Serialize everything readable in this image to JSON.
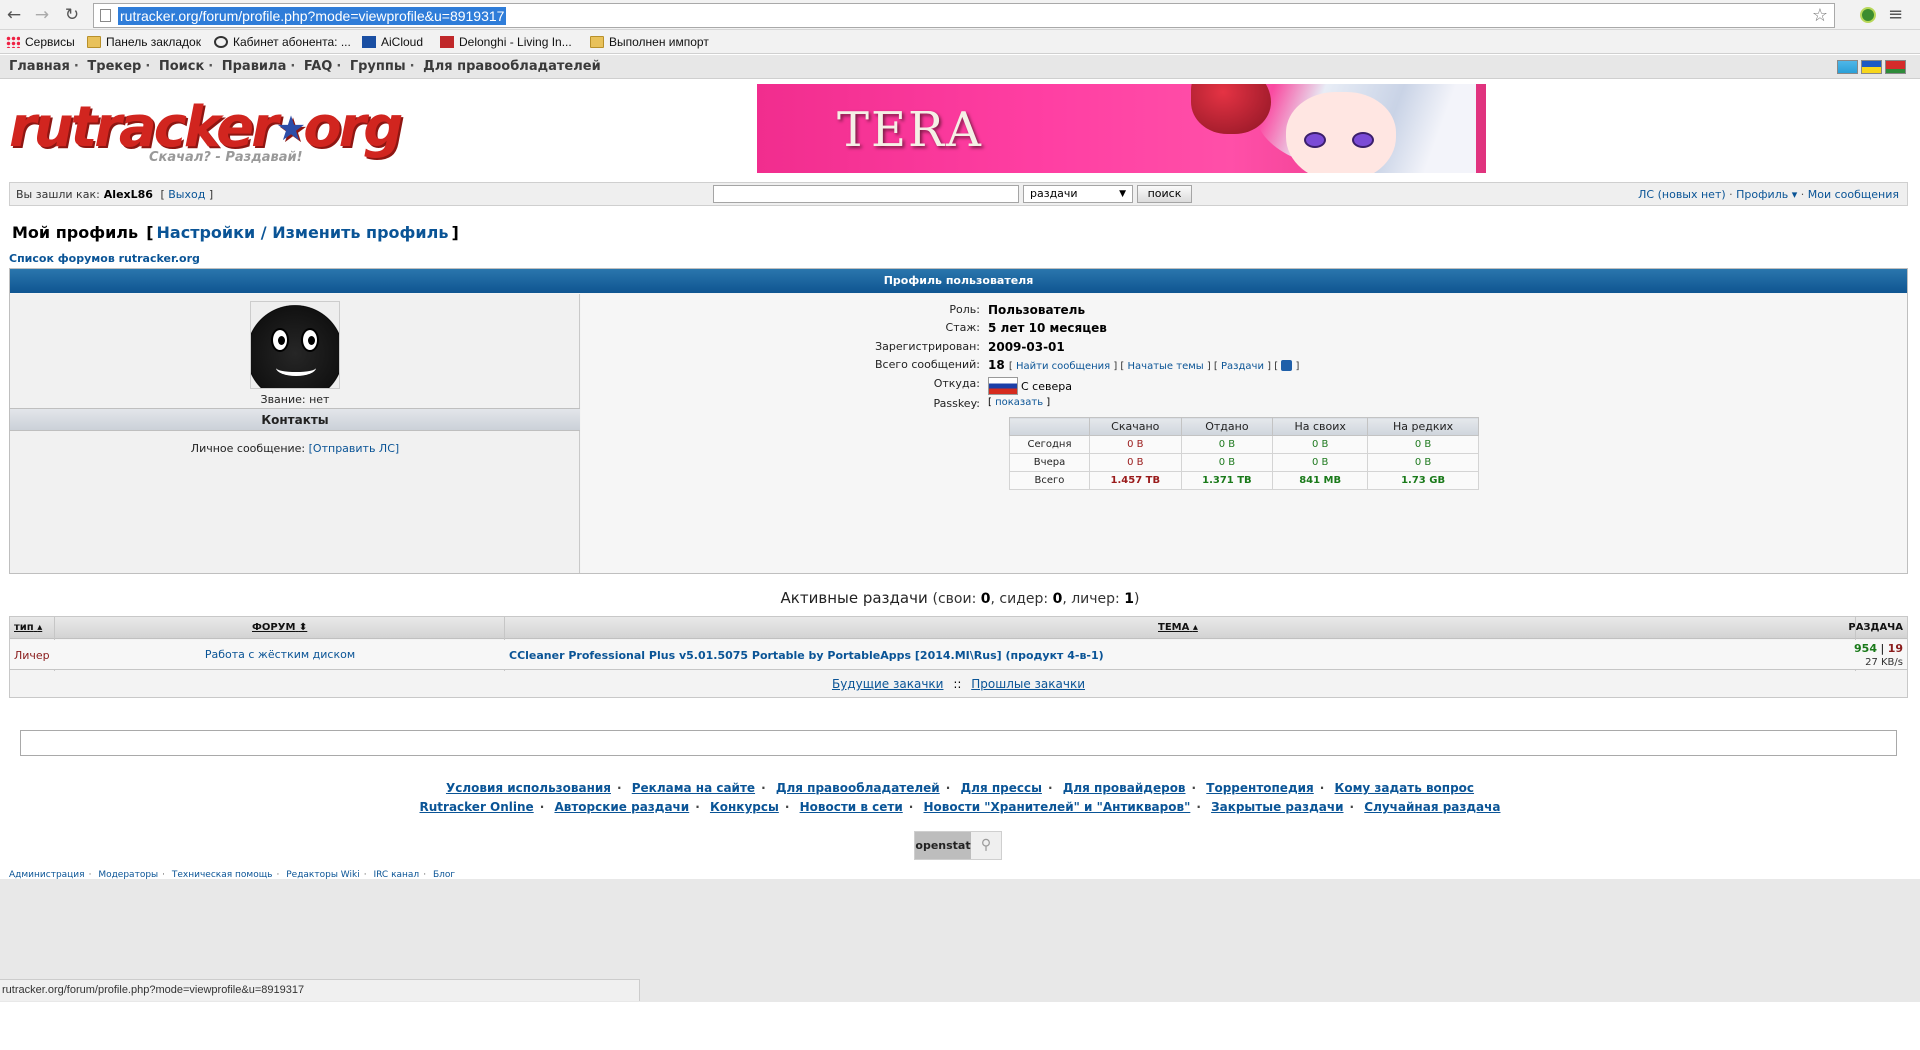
{
  "browser": {
    "url": "rutracker.org/forum/profile.php?mode=viewprofile&u=8919317",
    "bookmarks": [
      {
        "label": "Сервисы",
        "icon": "apps-icon"
      },
      {
        "label": "Панель закладок",
        "icon": "folder-icon"
      },
      {
        "label": "Кабинет абонента: ...",
        "icon": "gear-icon"
      },
      {
        "label": "AiCloud",
        "icon": "aicloud-icon"
      },
      {
        "label": "Delonghi - Living In...",
        "icon": "delonghi-icon"
      },
      {
        "label": "Выполнен импорт",
        "icon": "folder-icon"
      }
    ],
    "status_url": "rutracker.org/forum/profile.php?mode=viewprofile&u=8919317"
  },
  "topnav": {
    "items": [
      "Главная",
      "Трекер",
      "Поиск",
      "Правила",
      "FAQ",
      "Группы",
      "Для правообладателей"
    ]
  },
  "logo": {
    "text_a": "rutracker",
    "text_b": "org",
    "slogan": "Скачал? - Раздавай!"
  },
  "banner": {
    "title": "TERA"
  },
  "login": {
    "prefix": "Вы зашли как:",
    "username": "AlexL86",
    "logout": "Выход",
    "search_select": "раздачи",
    "search_button": "поиск",
    "pm": "ЛС (новых нет)",
    "profile": "Профиль",
    "my_messages": "Мои сообщения"
  },
  "page": {
    "title": "Мой профиль",
    "settings_link": "Настройки / Изменить профиль",
    "forums_link": "Список форумов rutracker.org"
  },
  "profile": {
    "header": "Профиль пользователя",
    "rank": "Звание: нет",
    "contacts_header": "Контакты",
    "pm_label": "Личное сообщение:",
    "pm_link": "[Отправить ЛС]",
    "role_label": "Роль:",
    "role": "Пользователь",
    "tenure_label": "Стаж:",
    "tenure": "5 лет 10 месяцев",
    "registered_label": "Зарегистрирован:",
    "registered": "2009-03-01",
    "posts_label": "Всего сообщений:",
    "posts": "18",
    "find_posts": "Найти сообщения",
    "started_topics": "Начатые темы",
    "releases": "Раздачи",
    "from_label": "Откуда:",
    "from": "С севера",
    "passkey_label": "Passkey:",
    "passkey_link": "показать"
  },
  "stats": {
    "headers": [
      "",
      "Скачано",
      "Отдано",
      "На своих",
      "На редких"
    ],
    "rows": [
      {
        "label": "Сегодня",
        "values": [
          "0 B",
          "0 B",
          "0 B",
          "0 B"
        ]
      },
      {
        "label": "Вчера",
        "values": [
          "0 B",
          "0 B",
          "0 B",
          "0 B"
        ]
      },
      {
        "label": "Всего",
        "values": [
          "1.457 TB",
          "1.371 TB",
          "841 MB",
          "1.73 GB"
        ]
      }
    ]
  },
  "active": {
    "title": "Активные раздачи",
    "own_label": "свои:",
    "own": "0",
    "seeder_label": "сидер:",
    "seeder": "0",
    "leecher_label": "личер:",
    "leecher": "1",
    "columns": [
      "тип",
      "ФОРУМ",
      "ТЕМА",
      "РАЗДАЧА"
    ],
    "rows": [
      {
        "type": "Личер",
        "forum": "Работа с жёстким диском",
        "topic": "CCleaner Professional Plus v5.01.5075 Portable by PortableApps [2014.MI\\Rus] (продукт 4-в-1)",
        "seeds": "954",
        "leeches": "19",
        "speed": "27 KB/s"
      }
    ],
    "future": "Будущие закачки",
    "past": "Прошлые закачки"
  },
  "footer": {
    "row1": [
      "Условия использования",
      "Реклама на сайте",
      "Для правообладателей",
      "Для прессы",
      "Для провайдеров",
      "Торрентопедия",
      "Кому задать вопрос"
    ],
    "row2": [
      "Rutracker Online",
      "Авторские раздачи",
      "Конкурсы",
      "Новости в сети",
      "Новости \"Хранителей\" и \"Антикваров\"",
      "Закрытые раздачи",
      "Случайная раздача"
    ],
    "openstat": "openstat",
    "row3": [
      "Администрация",
      "Модераторы",
      "Техническая помощь",
      "Редакторы Wiki",
      "IRC канал",
      "Блог"
    ]
  }
}
